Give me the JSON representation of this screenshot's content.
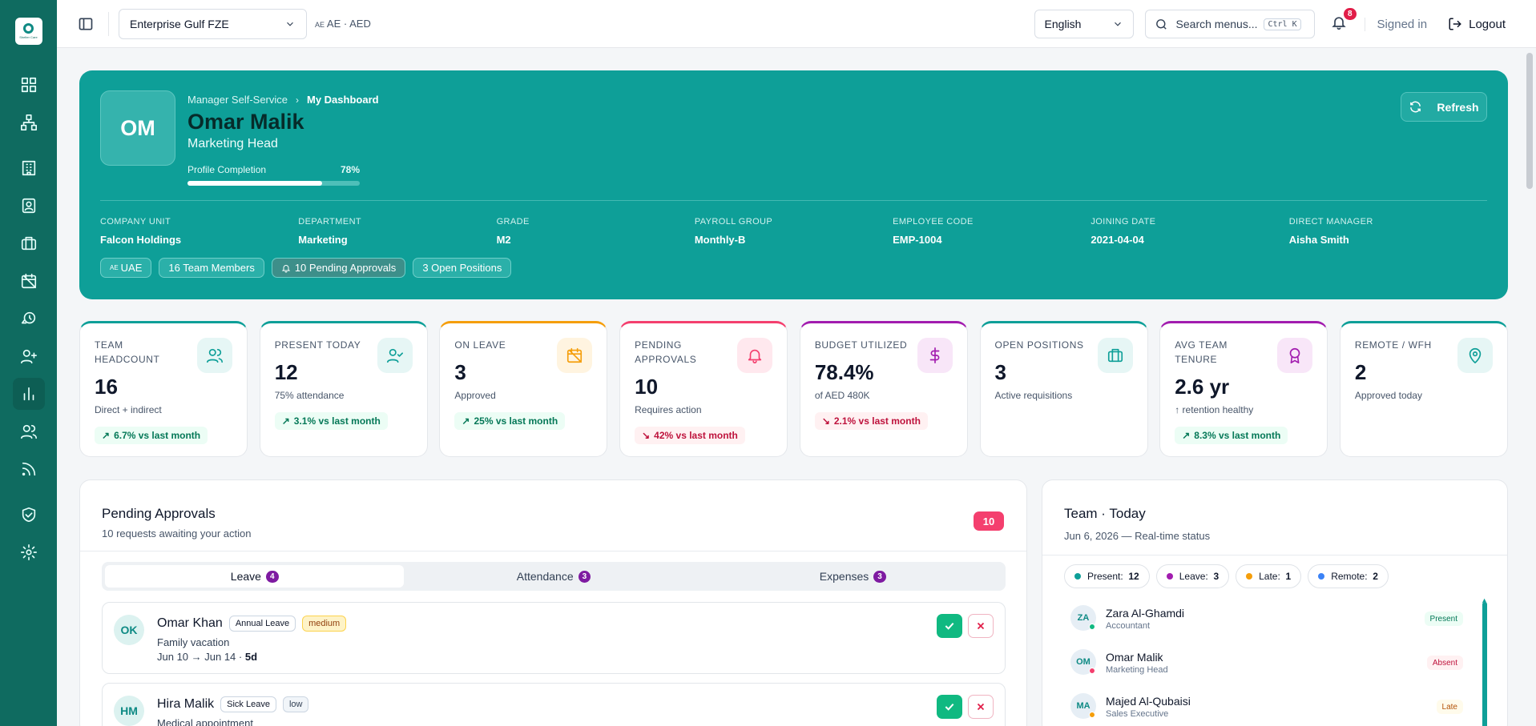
{
  "sidebar": {
    "logo_text": "Shelter Care",
    "items": [
      {
        "icon": "dashboard-icon"
      },
      {
        "icon": "org-chart-icon"
      },
      {
        "icon": "building-icon"
      },
      {
        "icon": "contact-card-icon"
      },
      {
        "icon": "briefcase-icon"
      },
      {
        "icon": "calendar-off-icon"
      },
      {
        "icon": "clock-history-icon"
      },
      {
        "icon": "user-plus-icon"
      },
      {
        "icon": "bar-chart-icon"
      },
      {
        "icon": "users-icon"
      },
      {
        "icon": "rss-icon"
      },
      {
        "icon": "shield-check-icon"
      },
      {
        "icon": "gear-icon"
      }
    ]
  },
  "topbar": {
    "company": "Enterprise Gulf FZE",
    "currency_flag": "AE",
    "currency": "AE · AED",
    "language": "English",
    "search_placeholder": "Search menus...",
    "shortcut": "Ctrl K",
    "notification_count": "8",
    "signed_in": "Signed in",
    "logout": "Logout"
  },
  "hero": {
    "initials": "OM",
    "breadcrumb_parent": "Manager Self-Service",
    "breadcrumb_current": "My Dashboard",
    "name": "Omar Malik",
    "role": "Marketing Head",
    "profile_label": "Profile Completion",
    "profile_value": "78%",
    "profile_pct": 0.78,
    "refresh": "Refresh",
    "meta": [
      {
        "label": "COMPANY UNIT",
        "value": "Falcon Holdings"
      },
      {
        "label": "DEPARTMENT",
        "value": "Marketing"
      },
      {
        "label": "GRADE",
        "value": "M2"
      },
      {
        "label": "PAYROLL GROUP",
        "value": "Monthly-B"
      },
      {
        "label": "EMPLOYEE CODE",
        "value": "EMP-1004"
      },
      {
        "label": "JOINING DATE",
        "value": "2021-04-04"
      },
      {
        "label": "DIRECT MANAGER",
        "value": "Aisha Smith"
      }
    ],
    "chips": {
      "country_flag": "AE",
      "country": "UAE",
      "team": "16 Team Members",
      "pending": "10 Pending Approvals",
      "open": "3 Open Positions"
    }
  },
  "kpis": [
    {
      "label": "TEAM HEADCOUNT",
      "value": "16",
      "sub": "Direct + indirect",
      "trend": "6.7% vs last month",
      "dir": "up",
      "icon": "users-icon",
      "color": "#0e9f98",
      "tint": "#e6f6f5"
    },
    {
      "label": "PRESENT TODAY",
      "value": "12",
      "sub": "75% attendance",
      "trend": "3.1% vs last month",
      "dir": "up",
      "icon": "user-check-icon",
      "color": "#0e9f98",
      "tint": "#e6f6f5"
    },
    {
      "label": "ON LEAVE",
      "value": "3",
      "sub": "Approved",
      "trend": "25% vs last month",
      "dir": "up",
      "icon": "calendar-off-icon",
      "color": "#f59e0b",
      "tint": "#fff4e0"
    },
    {
      "label": "PENDING APPROVALS",
      "value": "10",
      "sub": "Requires action",
      "trend": "42% vs last month",
      "dir": "down",
      "icon": "bell-icon",
      "color": "#f43f6e",
      "tint": "#ffe8ee"
    },
    {
      "label": "BUDGET UTILIZED",
      "value": "78.4%",
      "sub": "of AED 480K",
      "trend": "2.1% vs last month",
      "dir": "down",
      "icon": "dollar-icon",
      "color": "#a21caf",
      "tint": "#f8e6f8"
    },
    {
      "label": "OPEN POSITIONS",
      "value": "3",
      "sub": "Active requisitions",
      "trend": "",
      "dir": "",
      "icon": "briefcase-icon",
      "color": "#0e9f98",
      "tint": "#e6f6f5"
    },
    {
      "label": "AVG TEAM TENURE",
      "value": "2.6 yr",
      "sub": "↑ retention healthy",
      "trend": "8.3% vs last month",
      "dir": "up",
      "icon": "award-icon",
      "color": "#a21caf",
      "tint": "#f8e6f8"
    },
    {
      "label": "REMOTE / WFH",
      "value": "2",
      "sub": "Approved today",
      "trend": "",
      "dir": "",
      "icon": "map-pin-icon",
      "color": "#0e9f98",
      "tint": "#e6f6f5"
    }
  ],
  "approvals": {
    "title": "Pending Approvals",
    "subtitle": "10 requests awaiting your action",
    "count": "10",
    "tabs": [
      {
        "label": "Leave",
        "count": "4"
      },
      {
        "label": "Attendance",
        "count": "3"
      },
      {
        "label": "Expenses",
        "count": "3"
      }
    ],
    "requests": [
      {
        "initials": "OK",
        "name": "Omar Khan",
        "type": "Annual Leave",
        "priority": "medium",
        "reason": "Family vacation",
        "dates": "Jun 10 → Jun 14 · ",
        "days": "5d"
      },
      {
        "initials": "HM",
        "name": "Hira Malik",
        "type": "Sick Leave",
        "priority": "low",
        "reason": "Medical appointment",
        "dates": "",
        "days": ""
      }
    ]
  },
  "team": {
    "title": "Team · Today",
    "subtitle": "Jun 6, 2026 — Real-time status",
    "stats": [
      {
        "label": "Present:",
        "value": "12",
        "color": "#0e9f98"
      },
      {
        "label": "Leave:",
        "value": "3",
        "color": "#a21caf"
      },
      {
        "label": "Late:",
        "value": "1",
        "color": "#f59e0b"
      },
      {
        "label": "Remote:",
        "value": "2",
        "color": "#3b82f6"
      }
    ],
    "members": [
      {
        "initials": "ZA",
        "name": "Zara Al-Ghamdi",
        "role": "Accountant",
        "status": "Present",
        "dot": "#10b981"
      },
      {
        "initials": "OM",
        "name": "Omar Malik",
        "role": "Marketing Head",
        "status": "Absent",
        "dot": "#f43f6e"
      },
      {
        "initials": "MA",
        "name": "Majed Al-Qubaisi",
        "role": "Sales Executive",
        "status": "Late",
        "dot": "#f59e0b"
      }
    ]
  }
}
